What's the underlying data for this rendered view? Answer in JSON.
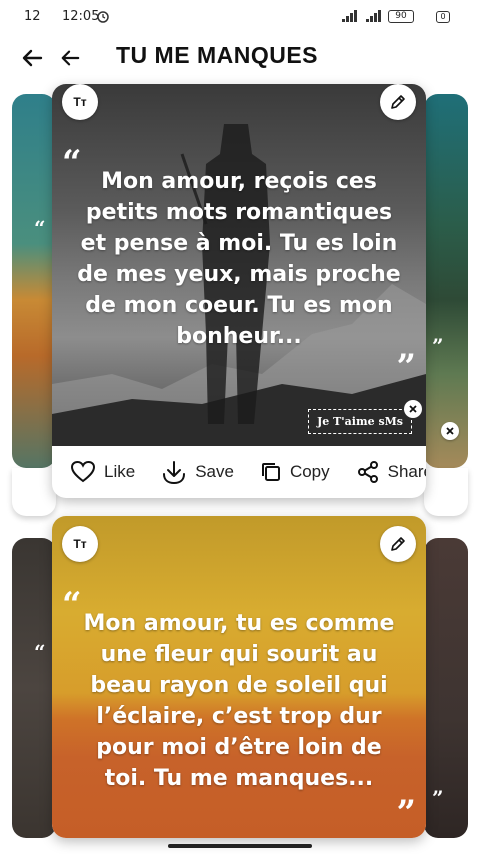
{
  "status_bar": {
    "left_number": "12",
    "time": "12:05",
    "battery": "90"
  },
  "app_bar": {
    "title": "TU ME MANQUES"
  },
  "cards": [
    {
      "font_button": "Tт",
      "quote": "Mon amour, reçois ces petits mots romantiques et pense à moi. Tu es loin de mes yeux, mais proche de mon coeur. Tu es mon bonheur...",
      "watermark": "Je T'aime sMs",
      "actions": {
        "like": "Like",
        "save": "Save",
        "copy": "Copy",
        "share": "Share"
      }
    },
    {
      "font_button": "Tт",
      "quote": "Mon amour, tu es comme une fleur qui sourit au beau rayon de soleil qui l’éclaire, c’est trop dur pour moi d’être loin de toi. Tu me manques..."
    }
  ],
  "colors": {
    "card1_bg": "#5b5b5b",
    "card2_bg_top": "#d8ac30",
    "card2_bg_bottom": "#c55e27"
  }
}
